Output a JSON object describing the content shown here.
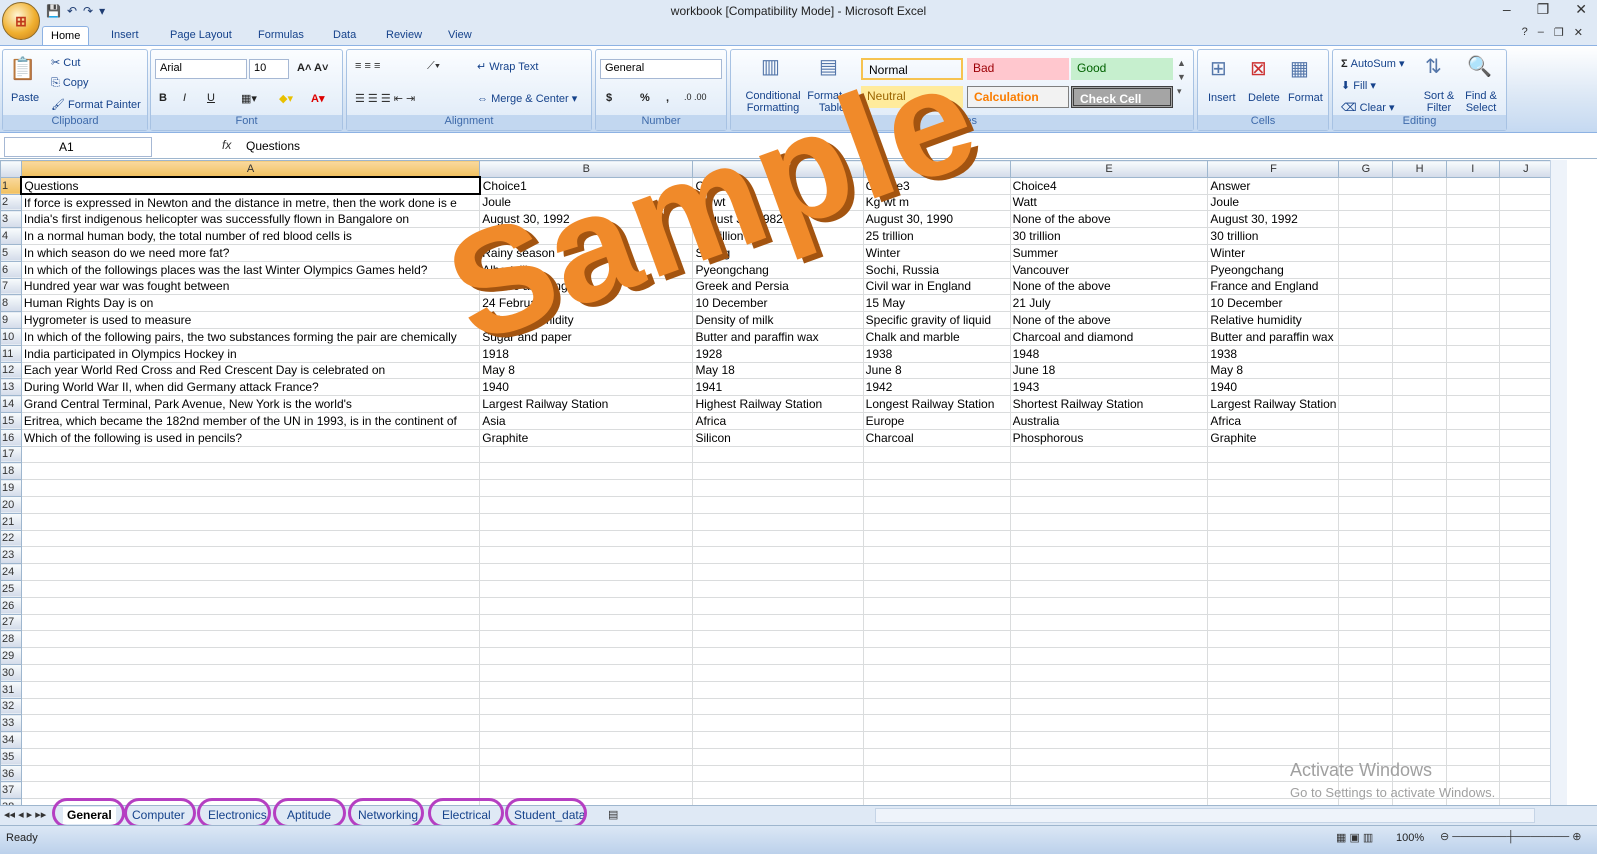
{
  "app": {
    "title": "workbook  [Compatibility Mode] - Microsoft Excel",
    "office_button": "⊞",
    "qat": [
      "💾",
      "↶",
      "↷",
      "▾"
    ]
  },
  "ribbon_tabs": [
    "Home",
    "Insert",
    "Page Layout",
    "Formulas",
    "Data",
    "Review",
    "View"
  ],
  "ribbon": {
    "clipboard": {
      "label": "Clipboard",
      "paste": "Paste",
      "cut": "Cut",
      "copy": "Copy",
      "format_painter": "Format Painter"
    },
    "font": {
      "label": "Font",
      "font_name": "Arial",
      "font_size": "10",
      "bold": "B",
      "italic": "I",
      "underline": "U"
    },
    "alignment": {
      "label": "Alignment",
      "wrap_text": "Wrap Text",
      "merge_center": "Merge & Center"
    },
    "number": {
      "label": "Number",
      "format": "General",
      "currency": "$",
      "percent": "%",
      "comma": ","
    },
    "styles": {
      "label": "Styles",
      "conditional": "Conditional Formatting",
      "format_table": "Format as Table",
      "cells": [
        {
          "name": "Normal",
          "bg": "#ffffff",
          "fg": "#000000"
        },
        {
          "name": "Bad",
          "bg": "#ffc7ce",
          "fg": "#9c0006"
        },
        {
          "name": "Good",
          "bg": "#c6efce",
          "fg": "#006100"
        },
        {
          "name": "Neutral",
          "bg": "#ffeb9c",
          "fg": "#9c6500"
        },
        {
          "name": "Calculation",
          "bg": "#f2f2f2",
          "fg": "#fa7d00"
        },
        {
          "name": "Check Cell",
          "bg": "#a5a5a5",
          "fg": "#ffffff"
        }
      ]
    },
    "cells": {
      "label": "Cells",
      "insert": "Insert",
      "delete": "Delete",
      "format": "Format"
    },
    "editing": {
      "label": "Editing",
      "autosum": "AutoSum",
      "fill": "Fill",
      "clear": "Clear",
      "sort_filter": "Sort & Filter",
      "find_select": "Find & Select"
    }
  },
  "formula_bar": {
    "name_box": "A1",
    "fx": "fx",
    "content": "Questions"
  },
  "columns": [
    "A",
    "B",
    "C",
    "D",
    "E",
    "F",
    "G",
    "H",
    "I",
    "J"
  ],
  "rows": [
    [
      "Questions",
      "Choice1",
      "Choice2",
      "Choice3",
      "Choice4",
      "Answer"
    ],
    [
      "If force is expressed in Newton and the distance in metre, then the work done is e",
      "Joule",
      "Kg wt",
      "Kg wt m",
      "Watt",
      "Joule"
    ],
    [
      "India's first indigenous helicopter was successfully flown in Bangalore on",
      "August 30, 1992",
      "August 30, 1982",
      "August 30, 1990",
      "None of the above",
      "August 30, 1992"
    ],
    [
      "In a normal human body, the total number of red blood cells is",
      "15 trillion",
      "20 trillion",
      "25 trillion",
      "30 trillion",
      "30 trillion"
    ],
    [
      "In which season do we need more fat?",
      "Rainy season",
      "Spring",
      "Winter",
      "Summer",
      "Winter"
    ],
    [
      "In which of the followings places was the last Winter Olympics Games held?",
      "Albertville",
      "Pyeongchang",
      "Sochi, Russia",
      "Vancouver",
      "Pyeongchang"
    ],
    [
      "Hundred year war was fought between",
      "France and England",
      "Greek and Persia",
      "Civil war in England",
      "None of the above",
      "France and England"
    ],
    [
      "Human Rights Day is on",
      "24 February",
      "10 December",
      "15 May",
      "21 July",
      "10 December"
    ],
    [
      "Hygrometer is used to measure",
      "Relative humidity",
      "Density of milk",
      "Specific gravity of liquid",
      "None of the above",
      "Relative humidity"
    ],
    [
      "In which of the following pairs, the two substances forming the pair are chemically",
      "Sugar and paper",
      "Butter and paraffin wax",
      "Chalk and marble",
      "Charcoal and diamond",
      "Butter and paraffin wax"
    ],
    [
      "India participated in Olympics Hockey in",
      "1918",
      "1928",
      "1938",
      "1948",
      "1938"
    ],
    [
      "Each year World Red Cross and Red Crescent Day is celebrated on",
      "May 8",
      "May 18",
      "June 8",
      "June 18",
      "May 8"
    ],
    [
      "During World War II, when did Germany attack France?",
      "1940",
      "1941",
      "1942",
      "1943",
      "1940"
    ],
    [
      "Grand Central Terminal, Park Avenue, New York is the world's",
      "Largest Railway Station",
      "Highest Railway Station",
      "Longest Railway Station",
      "Shortest Railway Station",
      "Largest Railway Station"
    ],
    [
      "Eritrea, which became the 182nd member of the UN in 1993, is in the continent of",
      "Asia",
      "Africa",
      "Europe",
      "Australia",
      "Africa"
    ],
    [
      "Which of the following is used in pencils?",
      "Graphite",
      "Silicon",
      "Charcoal",
      "Phosphorous",
      "Graphite"
    ]
  ],
  "sheet_tabs": [
    "General",
    "Computer",
    "Electronics",
    "Aptitude",
    "Networking",
    "Electrical",
    "Student_data"
  ],
  "watermark": "Sample",
  "activate": {
    "line1": "Activate Windows",
    "line2": "Go to Settings to activate Windows."
  },
  "status": {
    "left": "Ready",
    "zoom": "100%"
  }
}
